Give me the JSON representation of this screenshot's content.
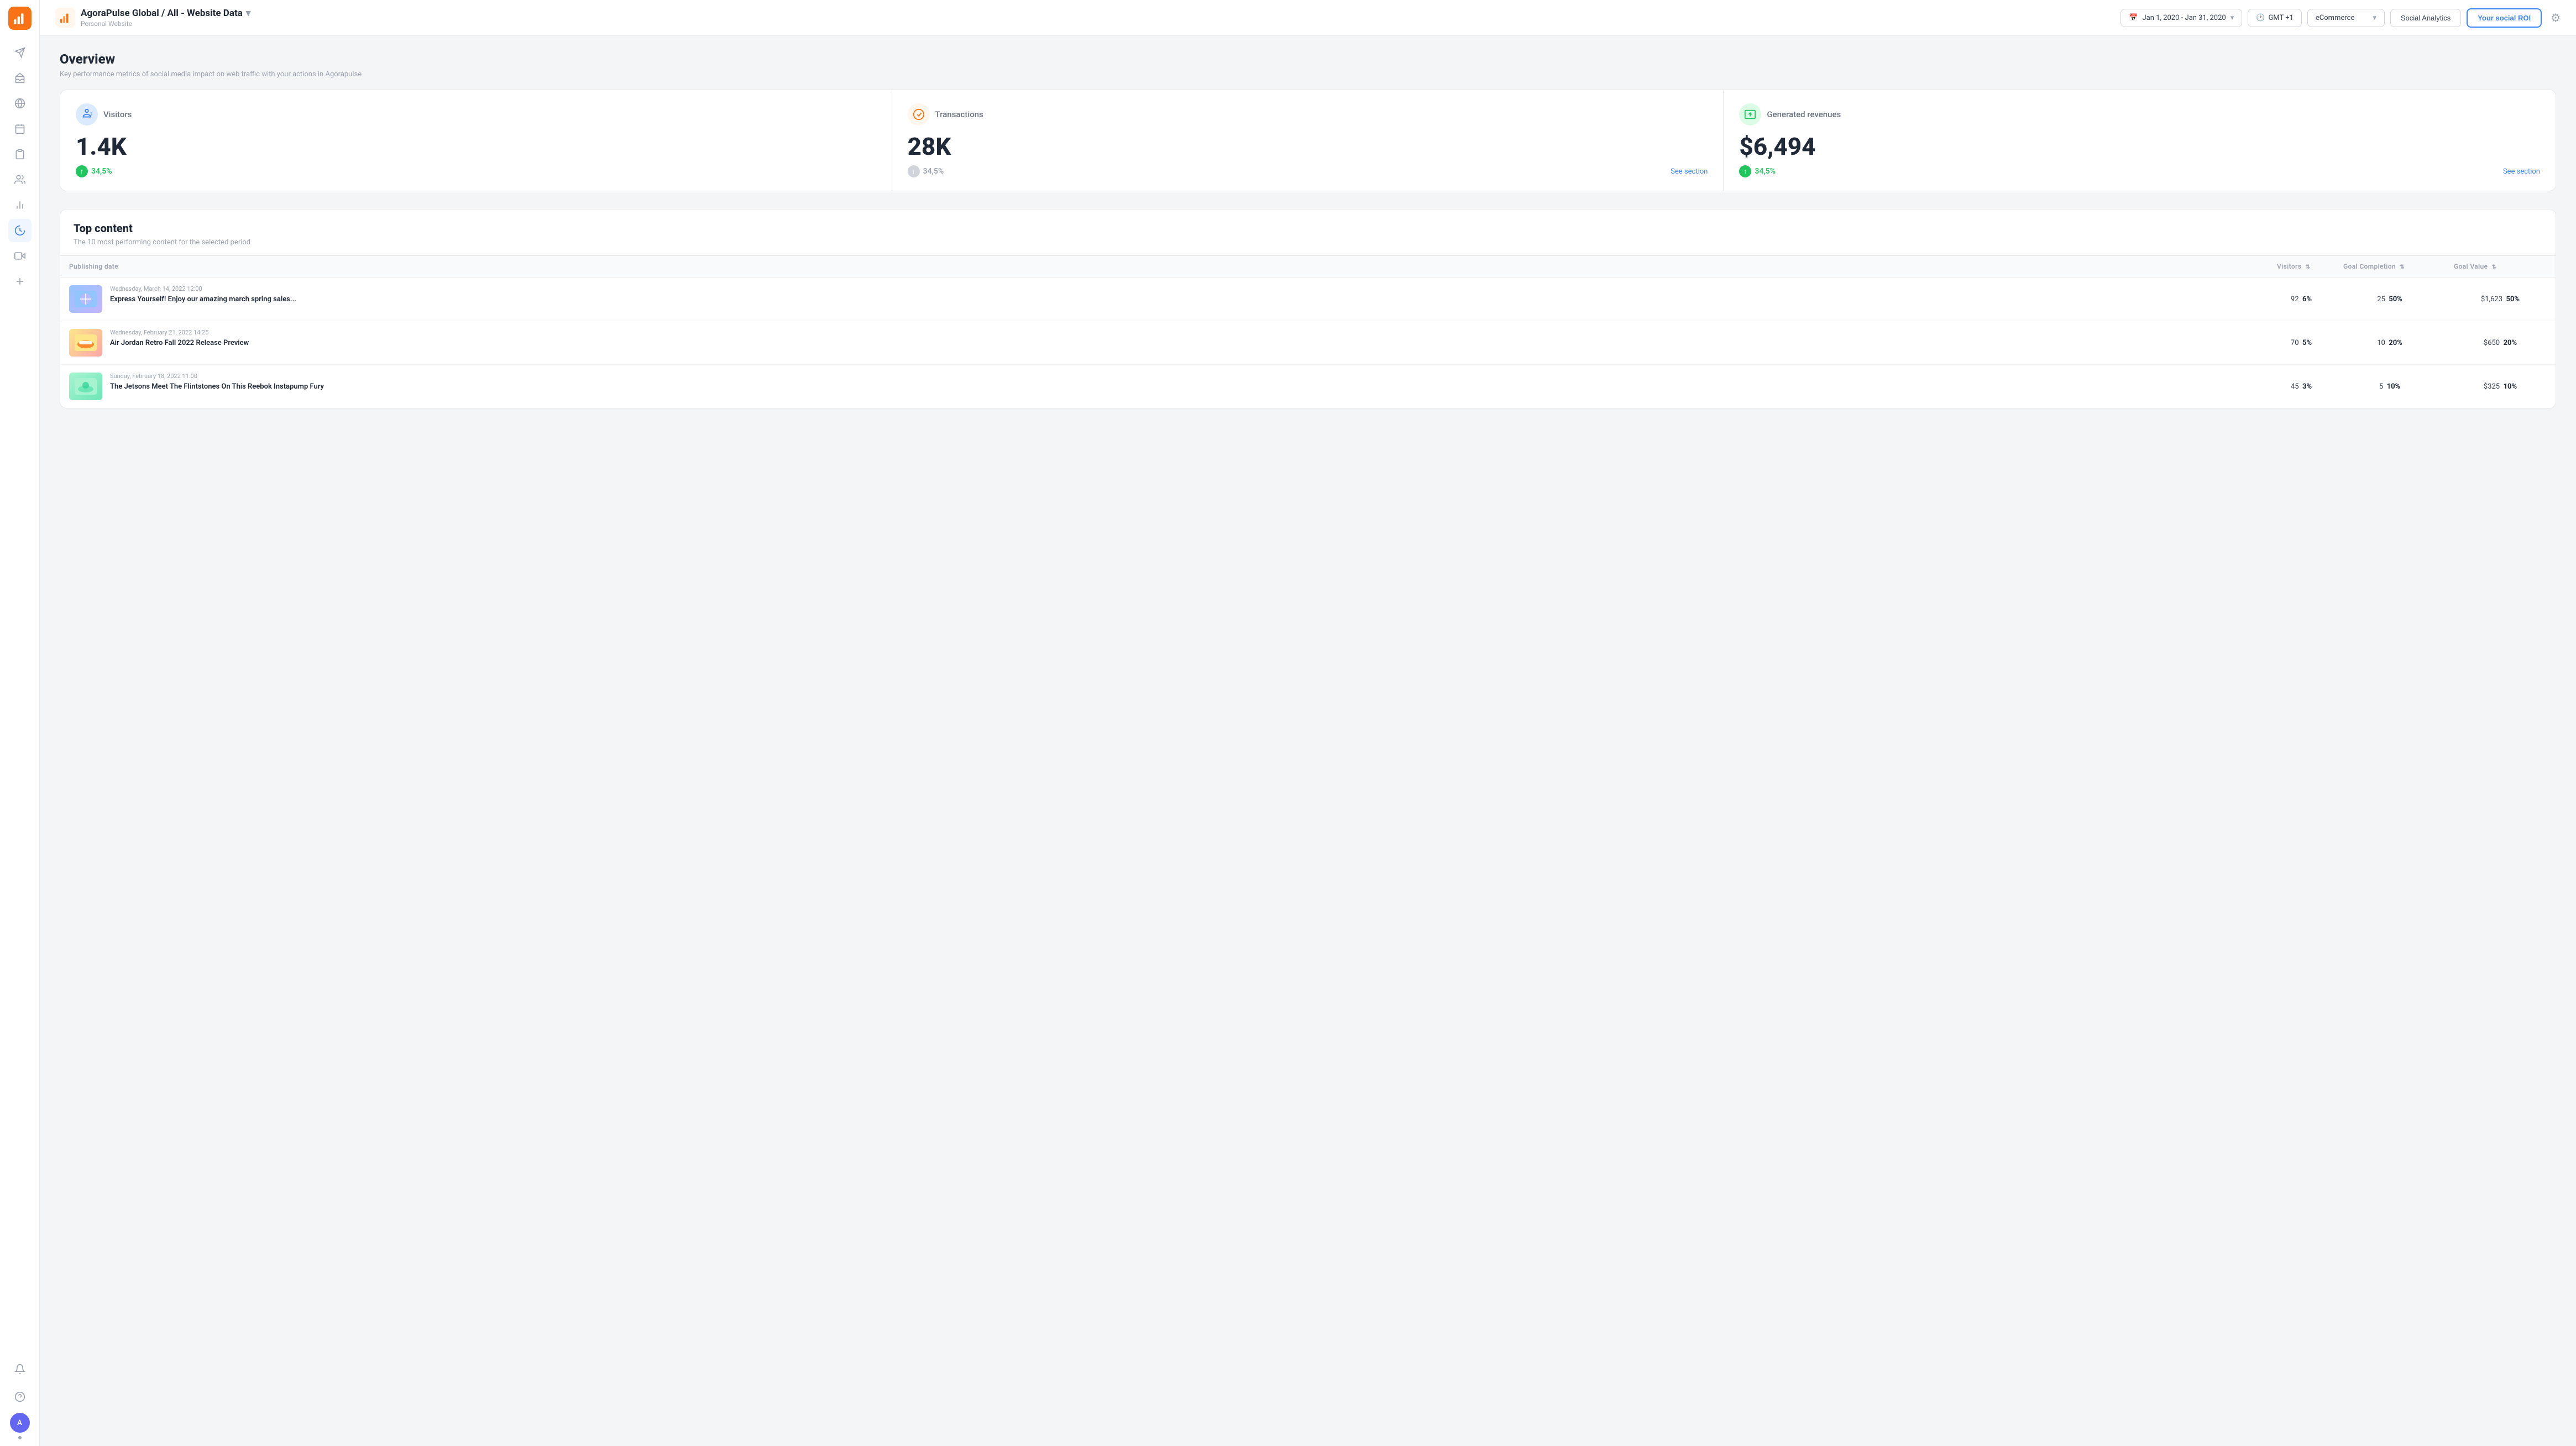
{
  "app": {
    "logo_icon": "bar-chart-icon",
    "logo_bg": "#f97316"
  },
  "header": {
    "title": "AgoraPulse Global / All - Website Data",
    "title_dropdown_icon": "chevron-down-icon",
    "subtitle": "Personal Website",
    "date_range": "Jan 1, 2020 - Jan 31, 2020",
    "timezone": "GMT +1",
    "ecommerce_label": "eCommerce",
    "social_analytics_label": "Social Analytics",
    "social_roi_label": "Your social ROI",
    "gear_icon": "gear-icon"
  },
  "sidebar": {
    "nav_items": [
      {
        "id": "send",
        "icon": "send-icon"
      },
      {
        "id": "inbox",
        "icon": "inbox-icon"
      },
      {
        "id": "globe",
        "icon": "globe-icon"
      },
      {
        "id": "calendar",
        "icon": "calendar-icon"
      },
      {
        "id": "clipboard",
        "icon": "clipboard-icon"
      },
      {
        "id": "users",
        "icon": "users-icon"
      },
      {
        "id": "chart",
        "icon": "chart-icon"
      },
      {
        "id": "dashboard",
        "icon": "dashboard-icon",
        "active": true
      },
      {
        "id": "video",
        "icon": "video-icon"
      },
      {
        "id": "plus",
        "icon": "plus-icon"
      }
    ],
    "bottom_items": [
      {
        "id": "bell",
        "icon": "bell-icon"
      },
      {
        "id": "help",
        "icon": "help-icon"
      }
    ],
    "avatar_initials": "A"
  },
  "overview": {
    "title": "Overview",
    "subtitle": "Key performance metrics of social media impact on web traffic with your actions in Agorapulse",
    "metrics": [
      {
        "id": "visitors",
        "icon": "visitors-icon",
        "icon_type": "blue",
        "label": "Visitors",
        "value": "1.4K",
        "change": "34,5%",
        "change_type": "up",
        "see_section": null
      },
      {
        "id": "transactions",
        "icon": "transactions-icon",
        "icon_type": "orange",
        "label": "Transactions",
        "value": "28K",
        "change": "34,5%",
        "change_type": "neutral",
        "see_section": "See section"
      },
      {
        "id": "revenues",
        "icon": "revenues-icon",
        "icon_type": "green",
        "label": "Generated revenues",
        "value": "$6,494",
        "change": "34,5%",
        "change_type": "up",
        "see_section": "See section"
      }
    ]
  },
  "top_content": {
    "title": "Top content",
    "subtitle": "The 10 most performing content for the selected period",
    "table": {
      "columns": [
        {
          "id": "publishing_date",
          "label": "Publishing date"
        },
        {
          "id": "visitors",
          "label": "Visitors",
          "sortable": true
        },
        {
          "id": "goal_completion",
          "label": "Goal Completion",
          "sortable": true
        },
        {
          "id": "goal_value",
          "label": "Goal Value",
          "sortable": true
        }
      ],
      "rows": [
        {
          "id": "row-1",
          "thumb_type": "spring",
          "date": "Wednesday, March 14, 2022 12:00",
          "title": "Express Yourself! Enjoy our amazing march spring sales...",
          "visitors": 92,
          "visitors_pct": "6%",
          "goal_completion": 25,
          "goal_completion_pct": "50%",
          "goal_value": "$1,623",
          "goal_value_pct": "50%"
        },
        {
          "id": "row-2",
          "thumb_type": "shoes",
          "date": "Wednesday, February 21, 2022 14:25",
          "title": "Air Jordan Retro Fall 2022 Release Preview",
          "visitors": 70,
          "visitors_pct": "5%",
          "goal_completion": 10,
          "goal_completion_pct": "20%",
          "goal_value": "$650",
          "goal_value_pct": "20%"
        },
        {
          "id": "row-3",
          "thumb_type": "jetsons",
          "date": "Sunday, February 18, 2022 11:00",
          "title": "The Jetsons Meet The Flintstones On This Reebok Instapump Fury",
          "visitors": 45,
          "visitors_pct": "3%",
          "goal_completion": 5,
          "goal_completion_pct": "10%",
          "goal_value": "$325",
          "goal_value_pct": "10%"
        }
      ]
    }
  }
}
